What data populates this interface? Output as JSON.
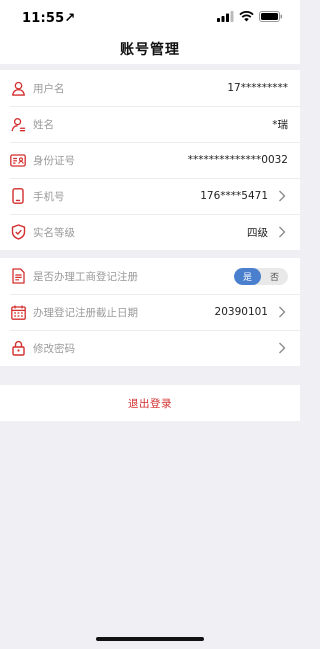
{
  "status_bar": {
    "time": "11:55",
    "location_glyph": "↗"
  },
  "nav": {
    "title": "账号管理"
  },
  "account_rows": [
    {
      "label": "用户名",
      "value": "17*********",
      "icon": "person-icon",
      "chevron": false
    },
    {
      "label": "姓名",
      "value": "*瑞",
      "icon": "person-edit-icon",
      "chevron": false
    },
    {
      "label": "身份证号",
      "value": "**************0032",
      "icon": "id-card-icon",
      "chevron": false
    },
    {
      "label": "手机号",
      "value": "176****5471",
      "icon": "phone-icon",
      "chevron": true
    },
    {
      "label": "实名等级",
      "value": "四级",
      "icon": "shield-check-icon",
      "chevron": true
    }
  ],
  "business": {
    "register_label": "是否办理工商登记注册",
    "toggle_yes": "是",
    "toggle_no": "否",
    "toggle_selected": "是",
    "deadline_label": "办理登记注册截止日期",
    "deadline_value": "20390101",
    "password_label": "修改密码"
  },
  "logout": {
    "label": "退出登录"
  },
  "colors": {
    "accent_red": "#d32f2f",
    "toggle_blue": "#4a7fcd",
    "background": "#efeff4"
  }
}
